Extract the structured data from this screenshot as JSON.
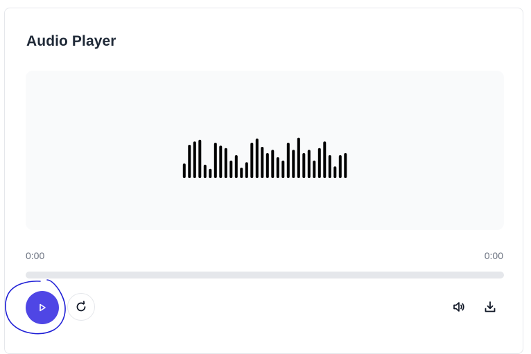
{
  "player": {
    "title": "Audio Player",
    "current_time": "0:00",
    "total_time": "0:00",
    "progress": 0,
    "accent_color": "#4f46e5",
    "annotation_color": "#1f1fd6",
    "waveform_levels": [
      0.35,
      0.8,
      0.88,
      0.92,
      0.32,
      0.22,
      0.85,
      0.78,
      0.72,
      0.42,
      0.55,
      0.25,
      0.38,
      0.85,
      0.95,
      0.75,
      0.6,
      0.68,
      0.5,
      0.42,
      0.85,
      0.68,
      0.97,
      0.6,
      0.68,
      0.42,
      0.72,
      0.88,
      0.55,
      0.28,
      0.55,
      0.6
    ]
  },
  "controls": {
    "play_icon": "play-icon",
    "replay_icon": "replay-icon",
    "volume_icon": "volume-icon",
    "download_icon": "download-icon"
  }
}
